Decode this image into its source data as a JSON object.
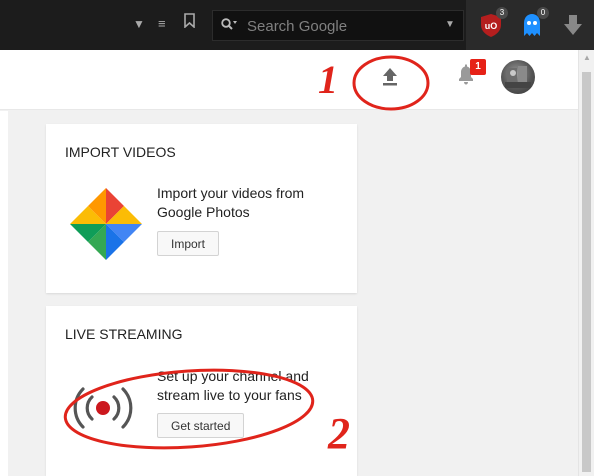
{
  "browser": {
    "search": {
      "placeholder": "Search Google"
    },
    "extensions": [
      {
        "name": "ublock-origin",
        "icon": "ublock-icon",
        "badge": "3",
        "color": "#b41e1e"
      },
      {
        "name": "ghostery",
        "icon": "ghost-icon",
        "badge": "0",
        "color": "#1e90ff"
      },
      {
        "name": "download",
        "icon": "download-arrow-icon"
      }
    ]
  },
  "header": {
    "upload_icon": "upload-arrow-icon",
    "notifications_icon": "bell-icon",
    "notifications_count": "1",
    "avatar_icon": "avatar"
  },
  "cards": {
    "import": {
      "title": "IMPORT VIDEOS",
      "text": "Import your videos from Google Photos",
      "button": "Import",
      "icon": "google-photos-icon"
    },
    "live": {
      "title": "LIVE STREAMING",
      "text": "Set up your channel and stream live to your fans",
      "button": "Get started",
      "icon": "live-stream-icon"
    }
  },
  "annotations": {
    "one": "1",
    "two": "2",
    "color": "#e0241b"
  }
}
